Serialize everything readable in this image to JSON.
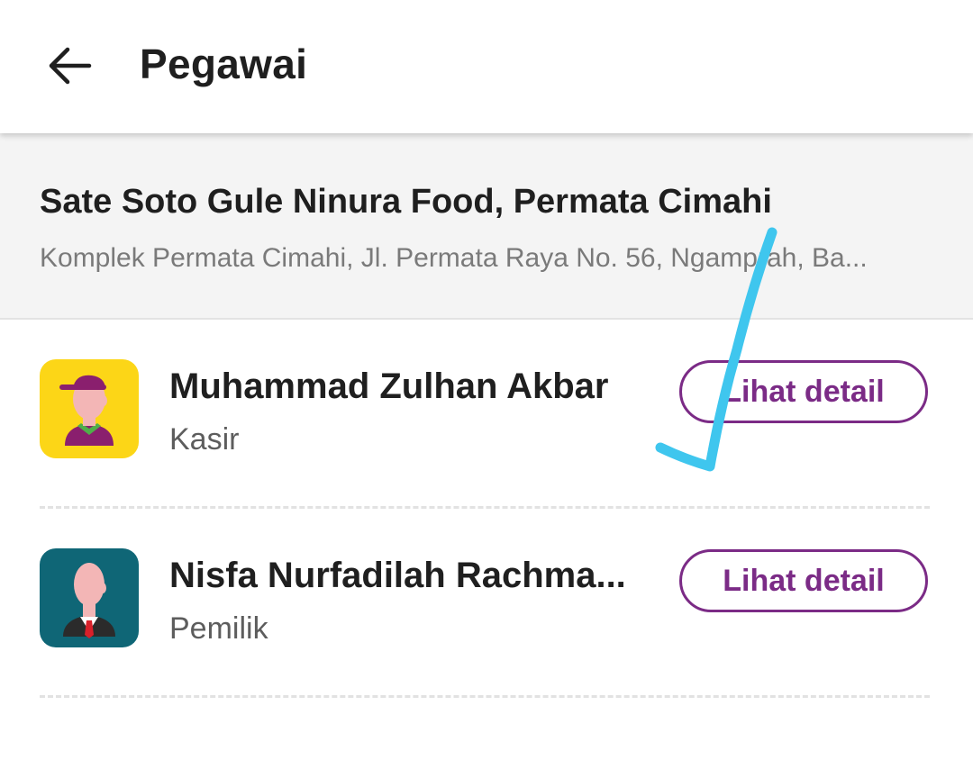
{
  "header": {
    "title": "Pegawai",
    "back_icon": "arrow-left-icon"
  },
  "outlet": {
    "name": "Sate Soto Gule Ninura Food, Permata Cimahi",
    "address": "Komplek Permata Cimahi, Jl. Permata Raya No. 56, Ngamprah, Ba..."
  },
  "employees": [
    {
      "name": "Muhammad Zulhan Akbar",
      "role": "Kasir",
      "button_label": "Lihat detail",
      "avatar_icon": "cashier-avatar-icon",
      "avatar_bg": "#fcd617"
    },
    {
      "name": "Nisfa Nurfadilah Rachma...",
      "role": "Pemilik",
      "button_label": "Lihat detail",
      "avatar_icon": "owner-avatar-icon",
      "avatar_bg": "#0f6676"
    }
  ],
  "colors": {
    "accent": "#7b2b86",
    "annotation": "#3fc6ee"
  }
}
